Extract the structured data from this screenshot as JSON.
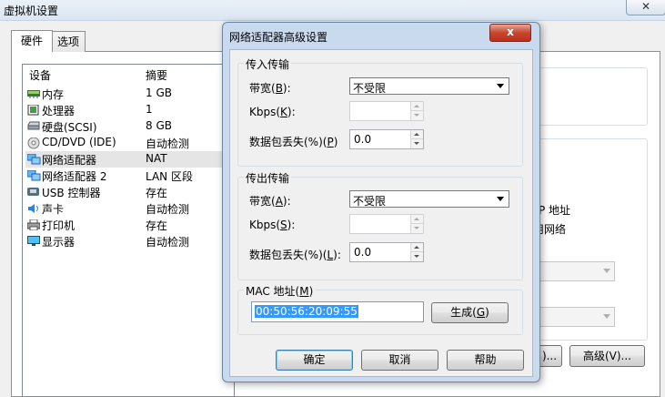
{
  "background_window": {
    "title": "虚拟机设置",
    "close_glyph": "✕",
    "tabs": [
      "硬件",
      "选项"
    ],
    "device_list": {
      "headers": [
        "设备",
        "摘要"
      ],
      "rows": [
        {
          "name": "内存",
          "summary": "1 GB",
          "icon": "memory-icon"
        },
        {
          "name": "处理器",
          "summary": "1",
          "icon": "processor-icon"
        },
        {
          "name": "硬盘(SCSI)",
          "summary": "8 GB",
          "icon": "hard-disk-icon"
        },
        {
          "name": "CD/DVD (IDE)",
          "summary": "自动检测",
          "icon": "cd-dvd-icon"
        },
        {
          "name": "网络适配器",
          "summary": "NAT",
          "icon": "network-adapter-icon"
        },
        {
          "name": "网络适配器 2",
          "summary": "LAN 区段",
          "icon": "network-adapter-icon"
        },
        {
          "name": "USB 控制器",
          "summary": "存在",
          "icon": "usb-icon"
        },
        {
          "name": "声卡",
          "summary": "自动检测",
          "icon": "sound-card-icon"
        },
        {
          "name": "打印机",
          "summary": "存在",
          "icon": "printer-icon"
        },
        {
          "name": "显示器",
          "summary": "自动检测",
          "icon": "display-icon"
        }
      ]
    },
    "right_fragments": {
      "text1": "P 地址",
      "text2": "用网络",
      "button_partial": ")...",
      "advanced_button": "高级(V)..."
    }
  },
  "dialog": {
    "title": "网络适配器高级设置",
    "close_glyph": "x",
    "incoming": {
      "group_title": "传入传输",
      "bandwidth_label": "带宽(",
      "bandwidth_key": "B",
      "bandwidth_suffix": "):",
      "bandwidth_value": "不受限",
      "kbps_label": "Kbps(",
      "kbps_key": "K",
      "kbps_suffix": "):",
      "kbps_value": "",
      "loss_label": "数据包丢失(%)(",
      "loss_key": "P",
      "loss_suffix": ")",
      "loss_value": "0.0"
    },
    "outgoing": {
      "group_title": "传出传输",
      "bandwidth_label": "带宽(",
      "bandwidth_key": "A",
      "bandwidth_suffix": "):",
      "bandwidth_value": "不受限",
      "kbps_label": "Kbps(",
      "kbps_key": "S",
      "kbps_suffix": "):",
      "kbps_value": "",
      "loss_label": "数据包丢失(%)(",
      "loss_key": "L",
      "loss_suffix": "):",
      "loss_value": "0.0"
    },
    "mac": {
      "group_title_prefix": "MAC 地址(",
      "group_title_key": "M",
      "group_title_suffix": ")",
      "value": "00:50:56:20:09:55",
      "generate_prefix": "生成(",
      "generate_key": "G",
      "generate_suffix": ")"
    },
    "buttons": {
      "ok": "确定",
      "cancel": "取消",
      "help": "帮助"
    }
  }
}
